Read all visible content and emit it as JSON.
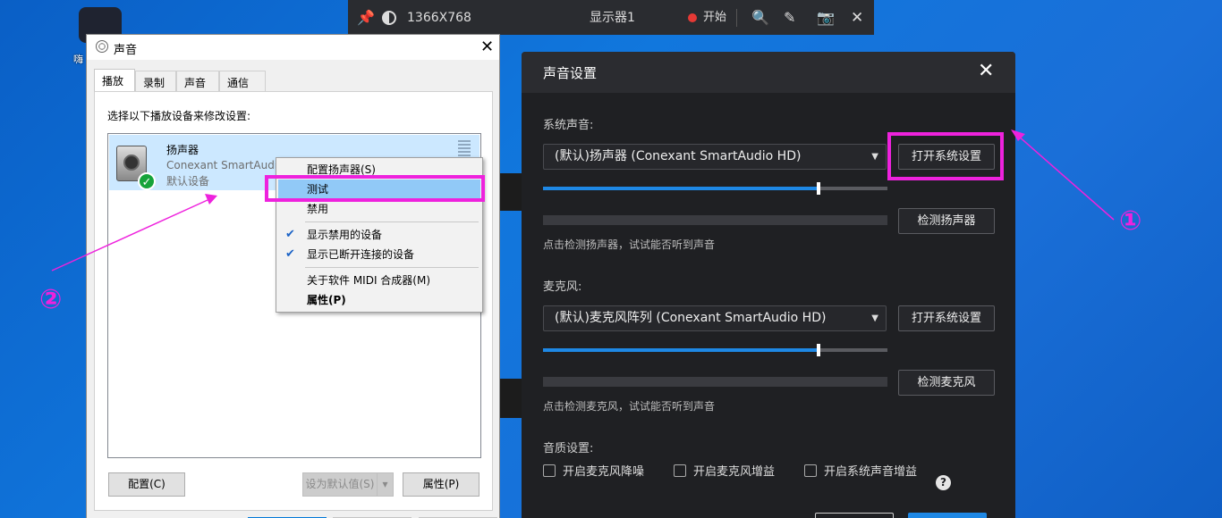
{
  "desktop": {
    "icon_label": "嗨"
  },
  "toolbar": {
    "resolution": "1366X768",
    "monitor": "显示器1",
    "start": "开始"
  },
  "sound_dialog": {
    "title": "声音",
    "tabs": [
      "播放",
      "录制",
      "声音",
      "通信"
    ],
    "instruction": "选择以下播放设备来修改设置:",
    "device": {
      "name": "扬声器",
      "driver": "Conexant SmartAudio",
      "status": "默认设备"
    },
    "buttons": {
      "configure": "配置(C)",
      "set_default": "设为默认值(S)",
      "properties": "属性(P)"
    }
  },
  "context_menu": {
    "items": [
      "配置扬声器(S)",
      "测试",
      "禁用",
      "显示禁用的设备",
      "显示已断开连接的设备",
      "关于软件 MIDI 合成器(M)",
      "属性(P)"
    ],
    "highlighted": 1
  },
  "settings_panel": {
    "title": "声音设置",
    "system_sound_label": "系统声音:",
    "speaker_select": "(默认)扬声器 (Conexant SmartAudio HD)",
    "open_system_settings": "打开系统设置",
    "speaker_volume": 0.8,
    "detect_speaker": "检测扬声器",
    "speaker_hint": "点击检测扬声器，试试能否听到声音",
    "mic_label": "麦克风:",
    "mic_select": "(默认)麦克风阵列 (Conexant SmartAudio HD)",
    "open_system_settings_mic": "打开系统设置",
    "mic_volume": 0.8,
    "detect_mic": "检测麦克风",
    "mic_hint": "点击检测麦克风，试试能否听到声音",
    "quality_label": "音质设置:",
    "checkboxes": [
      "开启麦克风降噪",
      "开启麦克风增益",
      "开启系统声音增益"
    ]
  },
  "annotations": {
    "one": "①",
    "two": "②"
  },
  "colors": {
    "annotation": "#ee22dd",
    "accent": "#1e88e5",
    "dark_bg": "#1f2023"
  }
}
